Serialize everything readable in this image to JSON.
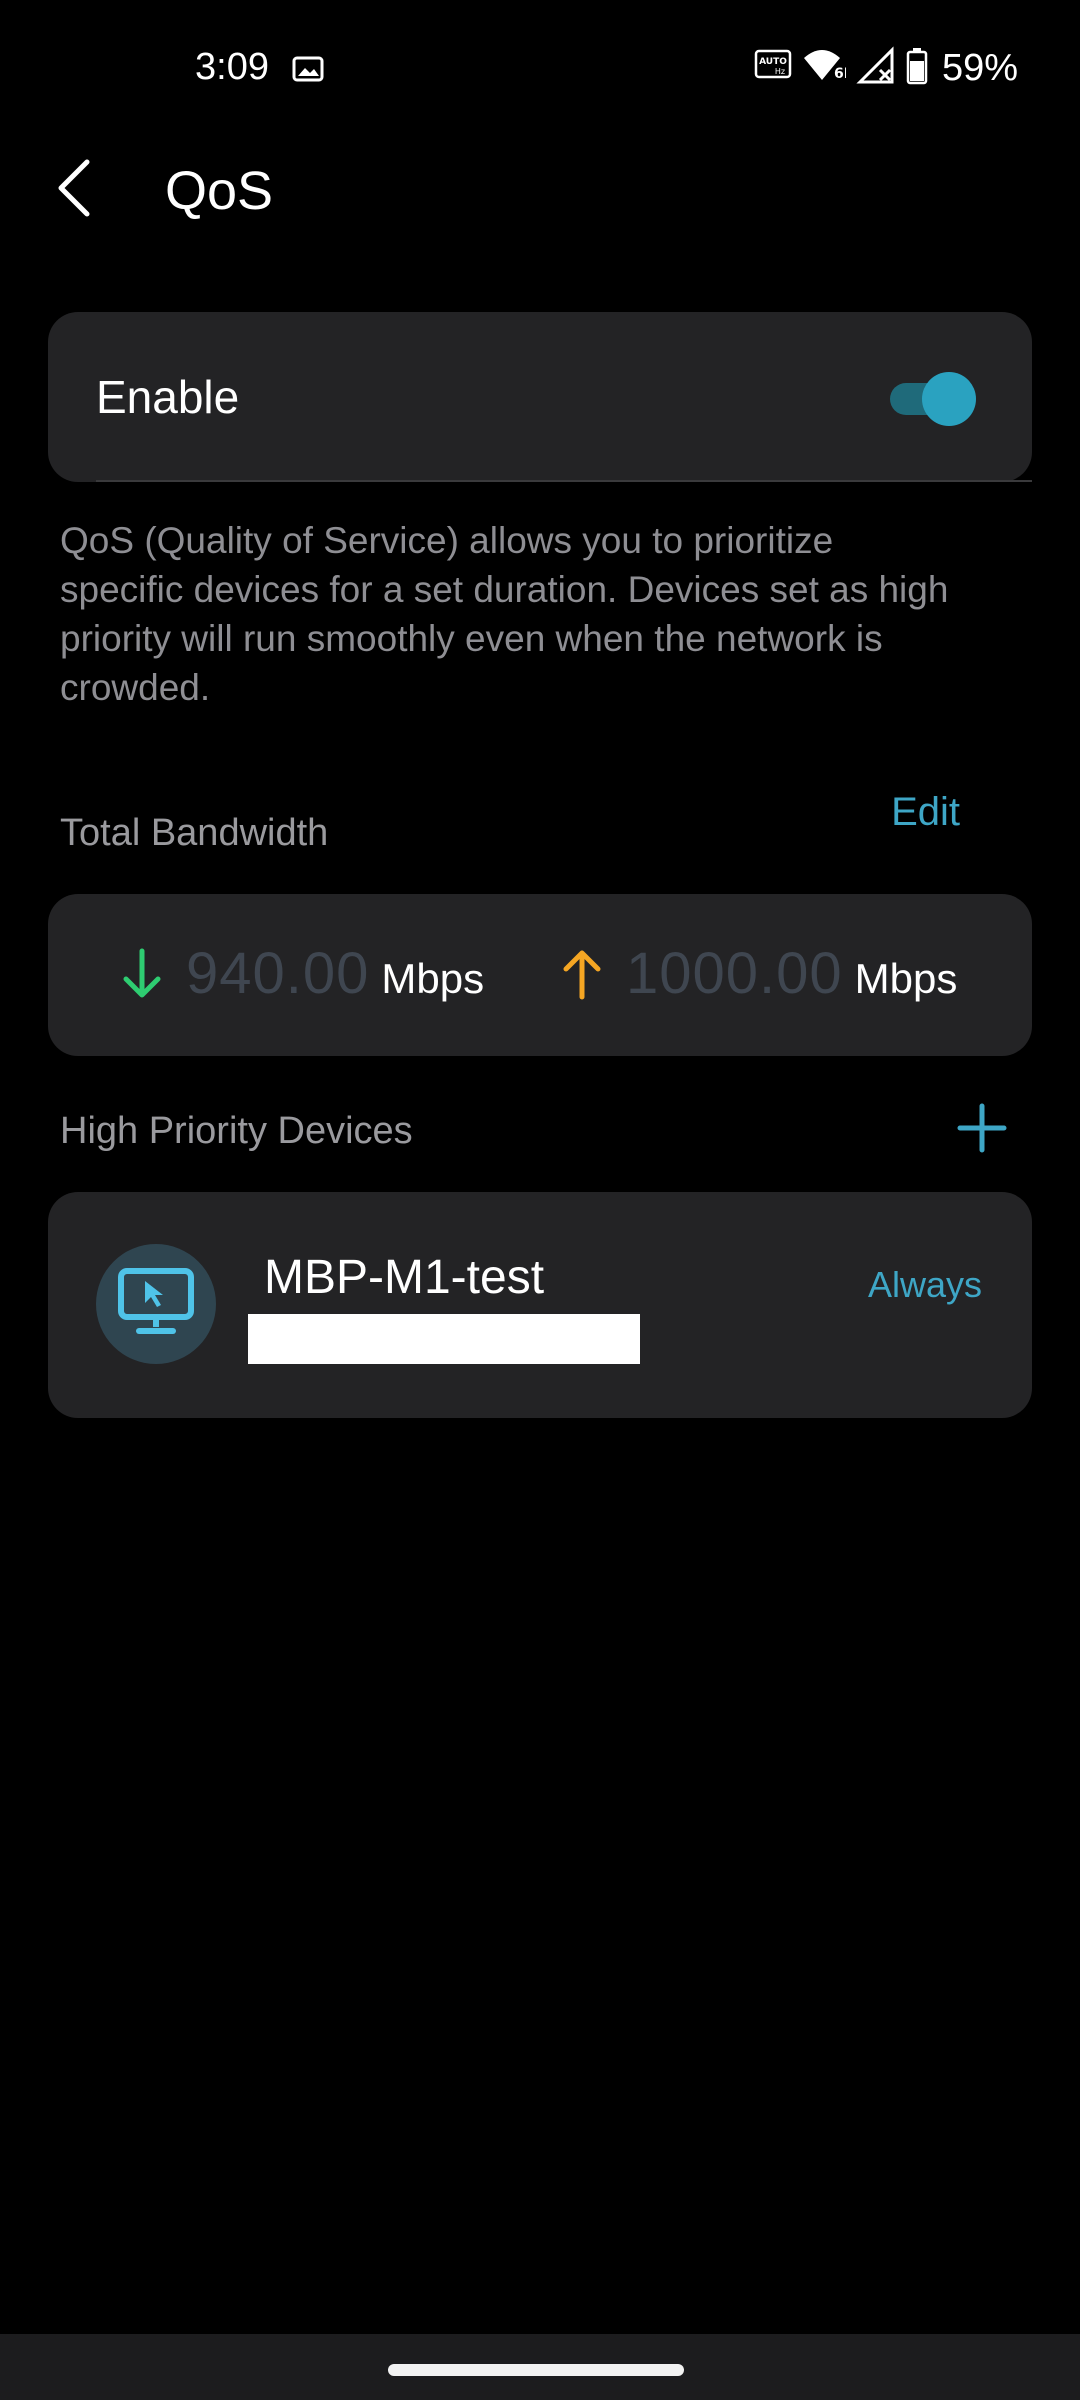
{
  "status_bar": {
    "time": "3:09",
    "battery_percent": "59%",
    "icons": [
      "image-icon",
      "auto-hz-icon",
      "wifi-6e-icon",
      "cellular-no-signal-icon",
      "battery-icon"
    ]
  },
  "header": {
    "title": "QoS",
    "back_icon": "back-chevron-icon"
  },
  "enable": {
    "label": "Enable",
    "enabled": true
  },
  "description": "QoS (Quality of Service) allows you to prioritize specific devices for a set duration. Devices set as high priority will run smoothly even when the network is crowded.",
  "bandwidth": {
    "section_title": "Total Bandwidth",
    "edit_label": "Edit",
    "download_value": "940.00",
    "download_unit": "Mbps",
    "upload_value": "1000.00",
    "upload_unit": "Mbps"
  },
  "high_priority": {
    "section_title": "High Priority Devices",
    "add_icon": "plus-icon",
    "devices": [
      {
        "name": "MBP-M1-test",
        "schedule": "Always",
        "icon": "computer-icon"
      }
    ]
  },
  "colors": {
    "accent": "#3ea6c6",
    "download_arrow": "#2ecc71",
    "upload_arrow": "#f5a623",
    "card_bg": "#232325"
  }
}
